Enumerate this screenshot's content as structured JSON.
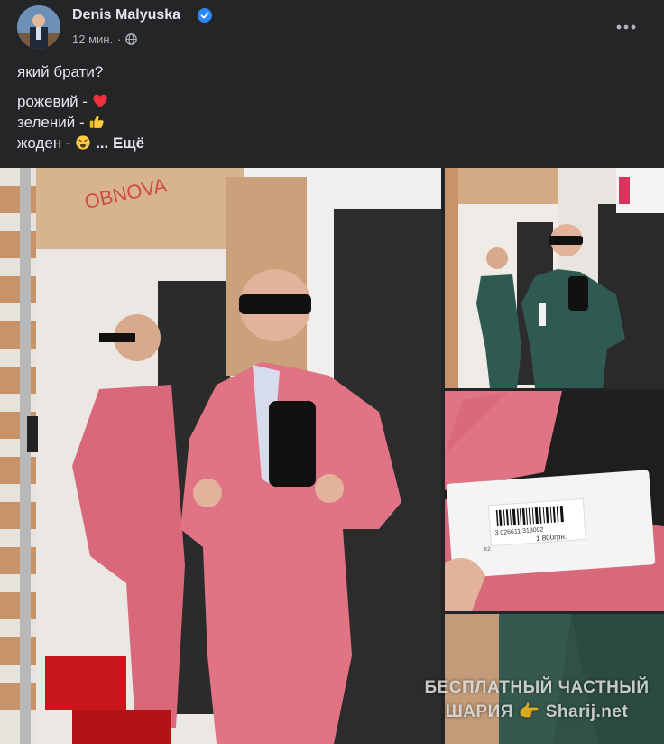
{
  "post": {
    "author": "Denis Malyuska",
    "time": "12 мин.",
    "separator": "·",
    "line1": "який брати?",
    "line2_prefix": "рожевий -",
    "line3_prefix": "зелений -",
    "line4_prefix": "жоден -",
    "see_more": "... Ещё"
  },
  "icons": {
    "verified": "verified-badge-icon",
    "privacy": "globe-icon",
    "more": "more-options-icon",
    "heart": "red-heart-emoji",
    "thumbs": "thumbs-up-emoji",
    "weary": "weary-face-emoji"
  },
  "photos": {
    "price_tag": {
      "barcode_number": "3 026611 318092",
      "price": "1 800грн.",
      "size": "К2"
    },
    "store_sign": "OBNOVA"
  },
  "watermark": {
    "line1": "БЕСПЛАТНЫЙ ЧАСТНЫЙ",
    "line2_word": "ШАРИЯ",
    "line2_site": "Sharij.net"
  },
  "colors": {
    "background": "#242526",
    "text": "#e4e6eb",
    "secondary_text": "#b0b3b8",
    "verified_blue": "#2d88ff",
    "pink_suit": "#e07384",
    "green_suit": "#2f5a52"
  }
}
